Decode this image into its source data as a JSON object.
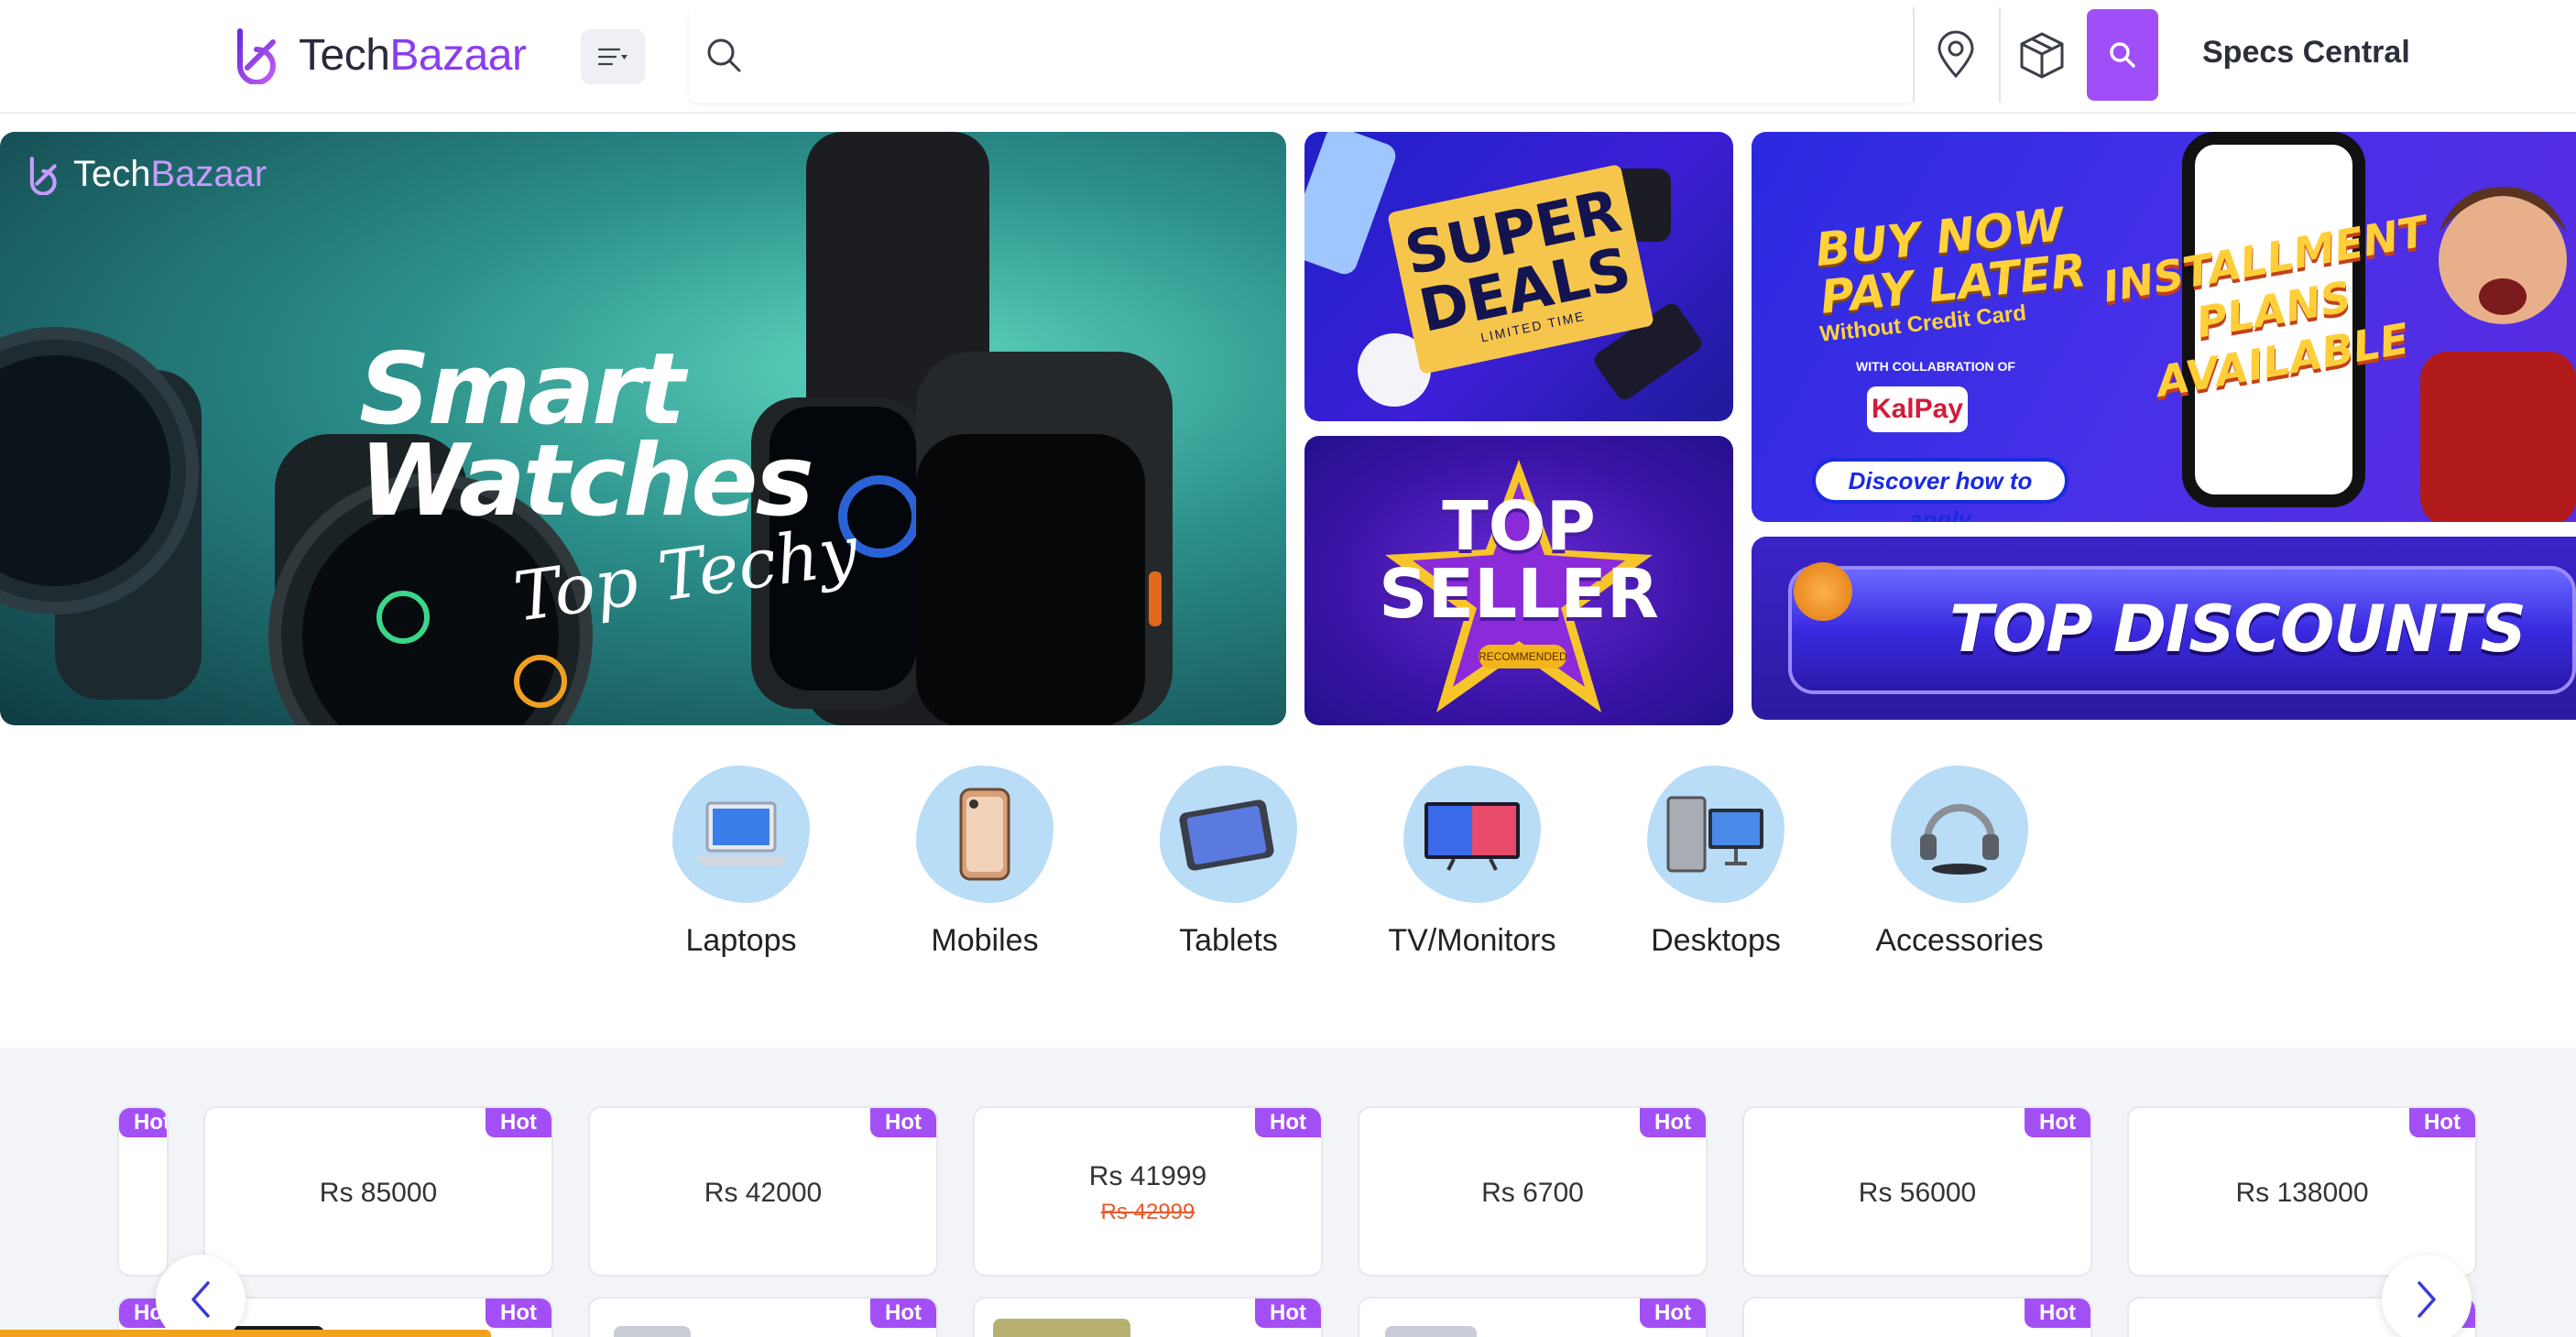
{
  "header": {
    "logo_tech": "Tech",
    "logo_bazaar": "Bazaar",
    "search_placeholder": "",
    "specs_label": "Specs Central"
  },
  "banners": {
    "main": {
      "brand_tech": "Tech",
      "brand_bazaar": "Bazaar",
      "title_line1": "Smart",
      "title_line2": "Watches",
      "subtitle": "Top Techy"
    },
    "super_deals": {
      "line1": "SUPER",
      "line2": "DEALS",
      "tag": "LIMITED TIME"
    },
    "top_seller": {
      "line1": "TOP",
      "line2": "SELLER",
      "badge": "RECOMMENDED"
    },
    "bnpl": {
      "line1": "BUY NOW",
      "line2": "PAY LATER",
      "line3": "Without Credit Card",
      "collab": "WITH COLLABRATION OF",
      "partner": "KalPay",
      "cta": "Discover how to apply",
      "promo": "INSTALLMENT PLANS AVAILABLE"
    },
    "discounts": {
      "title": "TOP DISCOUNTS"
    }
  },
  "categories": [
    {
      "label": "Laptops",
      "icon": "laptop-icon"
    },
    {
      "label": "Mobiles",
      "icon": "mobile-icon"
    },
    {
      "label": "Tablets",
      "icon": "tablet-icon"
    },
    {
      "label": "TV/Monitors",
      "icon": "tv-icon"
    },
    {
      "label": "Desktops",
      "icon": "desktop-icon"
    },
    {
      "label": "Accessories",
      "icon": "accessories-icon"
    }
  ],
  "products": {
    "hot_label": "Hot",
    "row1": [
      {
        "price": "Rs 85000",
        "old_price": ""
      },
      {
        "price": "Rs 42000",
        "old_price": ""
      },
      {
        "price": "Rs 41999",
        "old_price": "Rs 42999"
      },
      {
        "price": "Rs 6700",
        "old_price": ""
      },
      {
        "price": "Rs 56000",
        "old_price": ""
      },
      {
        "price": "Rs 138000",
        "old_price": ""
      }
    ]
  },
  "colors": {
    "accent": "#a34ff6",
    "brand_purple": "#8a3cf0",
    "category_blob": "#b9dcf7",
    "strike_price": "#e85a2a"
  }
}
